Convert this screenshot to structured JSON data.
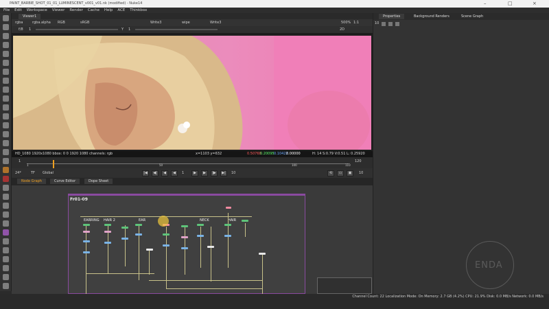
{
  "window": {
    "title": "PAINT_BARBIE_SHOT_01_01_LUMINESCENT_v001_v01.nk (modified) - Nuke14"
  },
  "menu": [
    "File",
    "Edit",
    "Workspace",
    "Viewer",
    "Render",
    "Cache",
    "Help",
    "ACE",
    "Thinkbox"
  ],
  "viewer": {
    "tab": "Viewer1",
    "channels": "rgba",
    "alpha": "rgba.alpha",
    "colorspace": "RGB",
    "display": "sRGB",
    "input_a": "Write3",
    "input_b": "Write3",
    "wipe": "wipe",
    "zoom": "500%",
    "ratio": "1:1",
    "mode": "2D",
    "frame_label": "f/8",
    "gain": "1",
    "y_label": "Y",
    "gamma": "1",
    "info_format": "HD_1080 1920x1080  bbox: 0 0 1920 1080 channels: rgb",
    "info_coords": "x=1103 y=632",
    "info_r": "0.50768",
    "info_g": "0.20095",
    "info_b": "0.10422",
    "info_a": "0.00000",
    "info_hsv": "H: 14 S:0.79 V:0.51  L: 0.25920"
  },
  "timeline": {
    "start": "1",
    "end": "120",
    "tick_100": "100",
    "tick_1": "1",
    "tick_50": "50",
    "tick_110": "110",
    "fps": "24*",
    "tf": "TF",
    "scope": "Global",
    "current_frame": "1",
    "step": "10",
    "playhead_fraction": 0.08,
    "right_end": "10"
  },
  "nodegraph": {
    "tabs": [
      "Node Graph",
      "Curve Editor",
      "Dope Sheet"
    ],
    "backdrop_title": "Fr01-09",
    "labels": [
      "EARRING",
      "HAIR 2",
      "EAR",
      "NECK",
      "HAIR"
    ]
  },
  "properties": {
    "tabs": [
      "Properties",
      "Background Renders",
      "Scene Graph"
    ],
    "count": "10"
  },
  "watermark": {
    "text": "ENDA"
  },
  "status": "Channel Count: 22  Localization Mode: On  Memory: 2.7 GB (4.2%)  CPU: 21.9%  Disk: 0.0 MB/s  Network: 0.0 MB/s",
  "colors": {
    "pink": "#eb8cbc",
    "accent": "#f0a020",
    "backdrop": "#8a4aa0"
  }
}
